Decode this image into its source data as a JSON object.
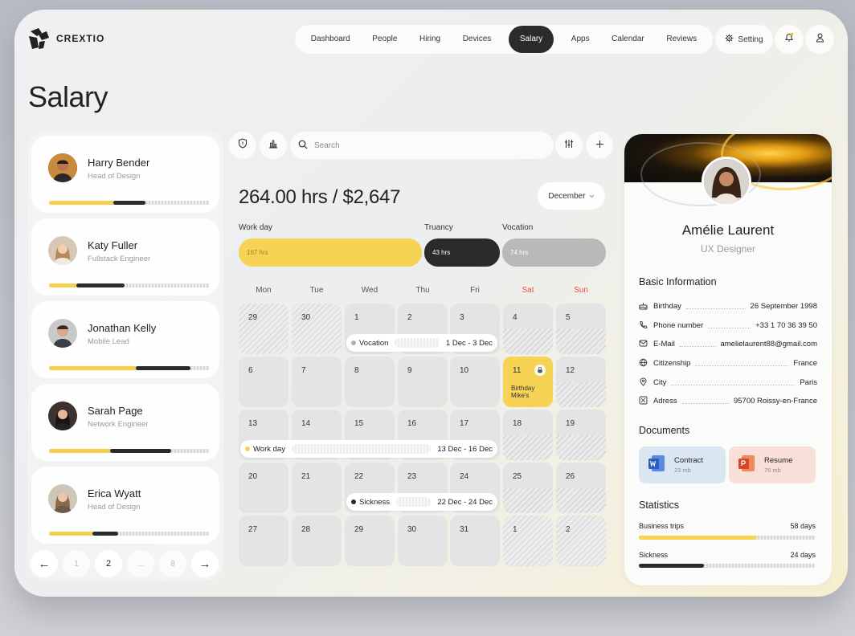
{
  "app": {
    "brand": "CREXTIO",
    "page_title": "Salary"
  },
  "nav": {
    "items": [
      {
        "label": "Dashboard"
      },
      {
        "label": "People"
      },
      {
        "label": "Hiring"
      },
      {
        "label": "Devices"
      },
      {
        "label": "Salary",
        "active": true
      },
      {
        "label": "Apps"
      },
      {
        "label": "Calendar"
      },
      {
        "label": "Reviews"
      }
    ],
    "setting_label": "Setting"
  },
  "employees": [
    {
      "name": "Harry Bender",
      "role": "Head of Design",
      "work_share": 0.4,
      "truancy_share": 0.2
    },
    {
      "name": "Katy Fuller",
      "role": "Fullstack Engineer",
      "work_share": 0.17,
      "truancy_share": 0.3
    },
    {
      "name": "Jonathan Kelly",
      "role": "Mobile Lead",
      "work_share": 0.54,
      "truancy_share": 0.34
    },
    {
      "name": "Sarah Page",
      "role": "Network Engineer",
      "work_share": 0.38,
      "truancy_share": 0.38
    },
    {
      "name": "Erica Wyatt",
      "role": "Head of Design",
      "work_share": 0.27,
      "truancy_share": 0.16
    }
  ],
  "pagination": {
    "pages": [
      "1",
      "2",
      "...",
      "8"
    ],
    "current": "2"
  },
  "toolbar": {
    "search_placeholder": "Search"
  },
  "summary": {
    "total": "264.00 hrs / $2,647",
    "month": "December"
  },
  "breakdown": [
    {
      "label": "Work day",
      "value": "167 hrs",
      "color": "#f6d255"
    },
    {
      "label": "Truancy",
      "value": "43 hrs",
      "color": "#2b2b2b"
    },
    {
      "label": "Vocation",
      "value": "74 hrs",
      "color": "#b9b9b9"
    }
  ],
  "calendar": {
    "weekdays": [
      "Mon",
      "Tue",
      "Wed",
      "Thu",
      "Fri",
      "Sat",
      "Sun"
    ],
    "weeks": [
      [
        "29",
        "30",
        "1",
        "2",
        "3",
        "4",
        "5"
      ],
      [
        "6",
        "7",
        "8",
        "9",
        "10",
        "11",
        "12"
      ],
      [
        "13",
        "14",
        "15",
        "16",
        "17",
        "18",
        "19"
      ],
      [
        "20",
        "21",
        "22",
        "23",
        "24",
        "25",
        "26"
      ],
      [
        "27",
        "28",
        "29",
        "30",
        "31",
        "1",
        "2"
      ]
    ],
    "highlight_event": {
      "day": "11",
      "text": "Birthday Mike's"
    },
    "events": [
      {
        "label": "Vocation",
        "range": "1 Dec - 3 Dec",
        "dot_color": "#b0b0b0"
      },
      {
        "label": "Work day",
        "range": "13 Dec - 16 Dec",
        "dot_color": "#f6d255"
      },
      {
        "label": "Sickness",
        "range": "22 Dec - 24 Dec",
        "dot_color": "#2b2b2b"
      }
    ]
  },
  "profile": {
    "name": "Amélie Laurent",
    "role": "UX Designer",
    "basic_title": "Basic Information",
    "info": [
      {
        "label": "Birthday",
        "value": "26 September 1998",
        "icon": "cake-icon"
      },
      {
        "label": "Phone number",
        "value": "+33 1 70 36 39 50",
        "icon": "phone-icon"
      },
      {
        "label": "E-Mail",
        "value": "amelielaurent88@gmail.com",
        "icon": "mail-icon"
      },
      {
        "label": "Citizenship",
        "value": "France",
        "icon": "globe-icon"
      },
      {
        "label": "City",
        "value": "Paris",
        "icon": "location-icon"
      },
      {
        "label": "Adress",
        "value": "95700 Roissy-en-France",
        "icon": "map-icon"
      }
    ],
    "documents_title": "Documents",
    "documents": [
      {
        "name": "Contract",
        "size": "23 mb",
        "icon": "word-icon",
        "color": "#2b5fbf"
      },
      {
        "name": "Resume",
        "size": "76 mb",
        "icon": "powerpoint-icon",
        "color": "#d2472b"
      }
    ],
    "statistics_title": "Statistics",
    "stats": [
      {
        "label": "Business trips",
        "value": "58 days",
        "fill": 0.67,
        "color": "#f6d255"
      },
      {
        "label": "Sickness",
        "value": "24 days",
        "fill": 0.37,
        "color": "#2b2b2b"
      }
    ]
  }
}
